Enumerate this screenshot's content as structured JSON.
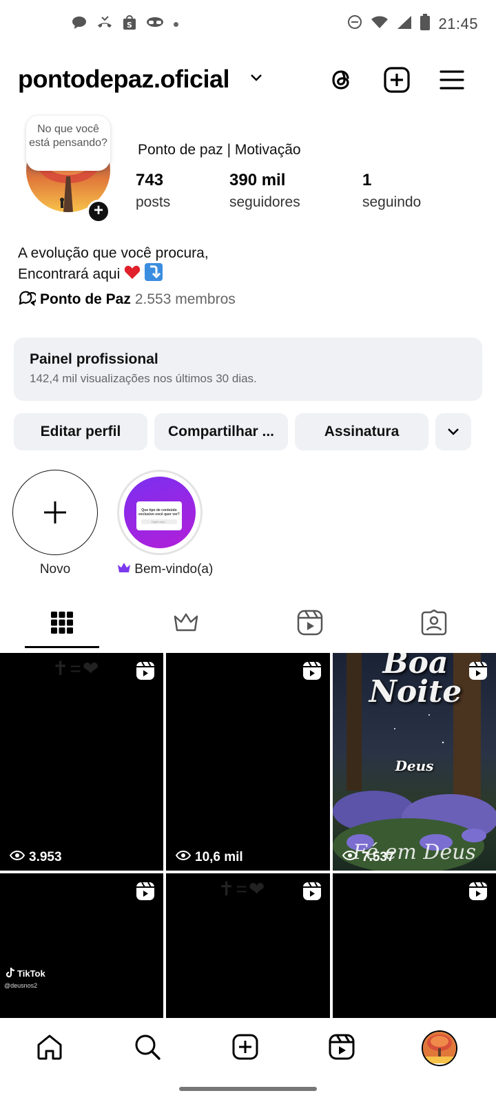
{
  "status_bar": {
    "time": "21:45",
    "left_icons": [
      "chat-icon",
      "missed-call-icon",
      "shop-icon",
      "sun-glasses-icon",
      "dot-icon"
    ],
    "right_icons": [
      "do-not-disturb-icon",
      "wifi-icon",
      "signal-icon",
      "battery-icon"
    ]
  },
  "header": {
    "username": "pontodepaz.oficial",
    "icons": [
      "threads-icon",
      "add-post-icon",
      "menu-icon"
    ]
  },
  "profile": {
    "note": "No que você está pensando?",
    "name": "Ponto de paz | Motivação",
    "stats": [
      {
        "value": "743",
        "label": "posts"
      },
      {
        "value": "390 mil",
        "label": "seguidores"
      },
      {
        "value": "1",
        "label": "seguindo"
      }
    ],
    "bio_line1": "A evolução que você procura,",
    "bio_line2": "Encontrará aqui",
    "bio_emojis": [
      "red-heart",
      "arrow-down-box"
    ],
    "community_name": "Ponto de Paz",
    "community_members": "2.553 membros"
  },
  "professional_panel": {
    "title": "Painel profissional",
    "subtitle": "142,4 mil visualizações nos últimos 30 dias."
  },
  "buttons": {
    "edit": "Editar perfil",
    "share": "Compartilhar ...",
    "subscription": "Assinatura"
  },
  "highlights": [
    {
      "label": "Novo"
    },
    {
      "label": "Bem-vindo(a)",
      "card_title": "Que tipo de conteúdo exclusivo você quer ver?",
      "card_placeholder": "Digite aqui..."
    }
  ],
  "tabs": [
    "grid-icon",
    "crown-icon",
    "reels-icon",
    "tagged-icon"
  ],
  "grid": [
    {
      "views": "3.953",
      "overlay": "✝=❤"
    },
    {
      "views": "10,6 mil"
    },
    {
      "views": "7.537",
      "overlay_title": "Boa Noite",
      "overlay_sub": "Deus",
      "overlay_bottom": "Fé em Deus"
    },
    {
      "views": "",
      "tiktok": "TikTok",
      "tiktok_user": "@deusnos2"
    },
    {
      "views": "",
      "overlay": "✝=❤"
    },
    {
      "views": ""
    }
  ],
  "bottom_nav": [
    "home-icon",
    "search-icon",
    "create-icon",
    "reels-icon",
    "profile-avatar"
  ],
  "colors": {
    "panel_bg": "#eff1f5",
    "accent_purple": "#a12ce0",
    "crown": "#7c3aed"
  }
}
